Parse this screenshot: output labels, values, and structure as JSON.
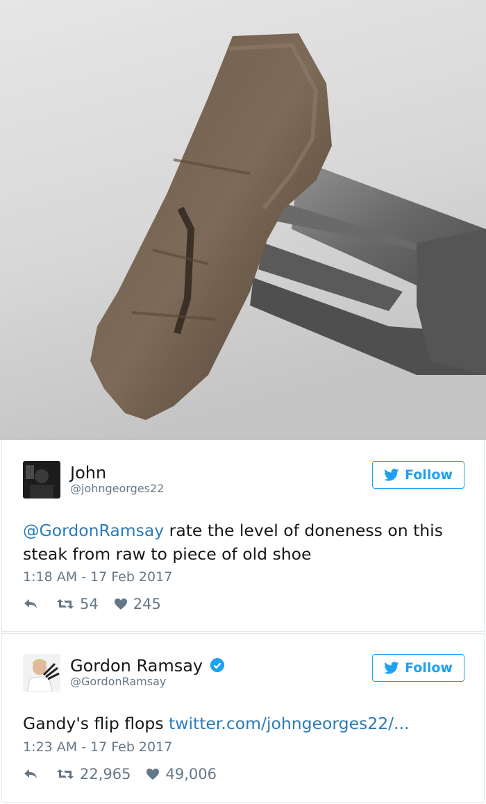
{
  "photo": {
    "icon": "steak-on-fork-photo"
  },
  "tweets": [
    {
      "name": "John",
      "handle": "@johngeorges22",
      "verified": false,
      "follow_label": "Follow",
      "mention": "@GordonRamsay",
      "text": " rate the level of doneness on this steak from raw to piece of old shoe",
      "timestamp": "1:18 AM - 17 Feb 2017",
      "retweets": "54",
      "likes": "245"
    },
    {
      "name": "Gordon Ramsay",
      "handle": "@GordonRamsay",
      "verified": true,
      "follow_label": "Follow",
      "text": "Gandy's flip flops ",
      "link": "twitter.com/johngeorges22/...",
      "timestamp": "1:23 AM - 17 Feb 2017",
      "retweets": "22,965",
      "likes": "49,006"
    }
  ],
  "colors": {
    "accent": "#1da1f2",
    "link": "#2b7bb9",
    "muted": "#657786"
  }
}
